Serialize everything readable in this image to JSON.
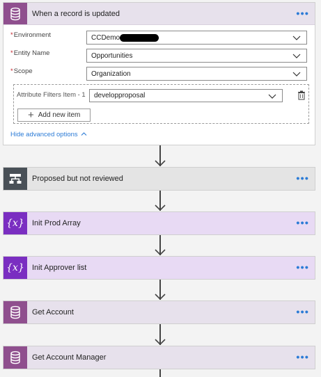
{
  "colors": {
    "db_icon_bg": "#8f4f8e",
    "variable_icon_bg": "#7a2ec1",
    "condition_icon_bg": "#495057",
    "link": "#2b7bd6",
    "required": "#c4262e"
  },
  "trigger": {
    "title": "When a record is updated",
    "icon": "database-icon",
    "more": "•••",
    "fields": [
      {
        "label": "Environment",
        "required": true,
        "value": "CCDemo"
      },
      {
        "label": "Entity Name",
        "required": true,
        "value": "Opportunities"
      },
      {
        "label": "Scope",
        "required": true,
        "value": "Organization"
      }
    ],
    "required_marker": "*",
    "filters": {
      "label": "Attribute Filters Item - 1",
      "value": "developproposal",
      "add_label": "Add new item",
      "add_icon": "plus-icon",
      "delete_icon": "delete-icon"
    },
    "advanced_link": "Hide advanced options",
    "advanced_icon": "chevron-up-icon"
  },
  "steps": [
    {
      "title": "Proposed but not reviewed",
      "icon": "condition-icon",
      "more": "•••"
    },
    {
      "title": "Init Prod Array",
      "icon": "variable-icon",
      "glyph": "{x}",
      "more": "•••"
    },
    {
      "title": "Init Approver list",
      "icon": "variable-icon",
      "glyph": "{x}",
      "more": "•••"
    },
    {
      "title": "Get Account",
      "icon": "database-icon",
      "more": "•••"
    },
    {
      "title": "Get Account Manager",
      "icon": "database-icon",
      "more": "•••"
    }
  ]
}
